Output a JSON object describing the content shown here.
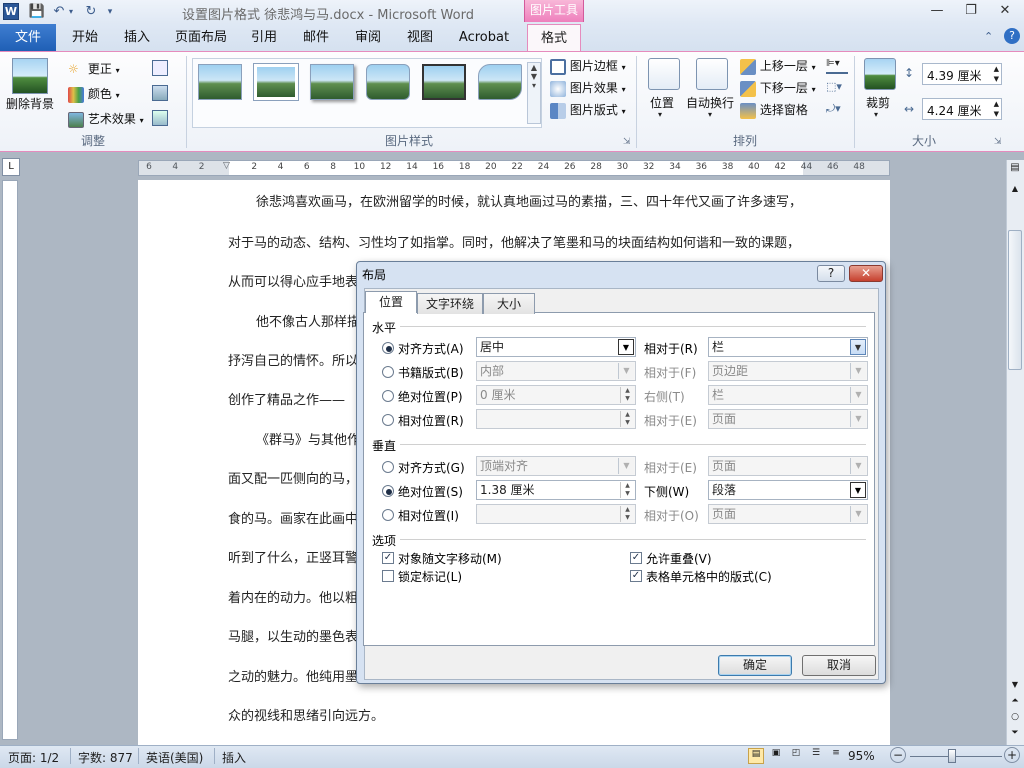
{
  "window": {
    "title": "设置图片格式 徐悲鸿与马.docx  -  Microsoft Word",
    "context_tab": "图片工具",
    "app_icon": "W",
    "controls": {
      "minimize": "—",
      "restore": "❐",
      "close": "✕"
    }
  },
  "tabs": {
    "file": "文件",
    "items": [
      "开始",
      "插入",
      "页面布局",
      "引用",
      "邮件",
      "审阅",
      "视图",
      "Acrobat"
    ],
    "active": "格式"
  },
  "ribbon": {
    "adjust": {
      "remove_bg": "删除背景",
      "corrections": "更正",
      "color": "颜色",
      "artistic": "艺术效果",
      "label": "调整"
    },
    "picture_styles": {
      "border": "图片边框",
      "effects": "图片效果",
      "layout": "图片版式",
      "label": "图片样式"
    },
    "arrange": {
      "position": "位置",
      "wrap": "自动换行",
      "bring_forward": "上移一层",
      "send_backward": "下移一层",
      "selection_pane": "选择窗格",
      "label": "排列"
    },
    "size": {
      "crop": "裁剪",
      "height": "4.39 厘米",
      "width": "4.24 厘米",
      "label": "大小"
    }
  },
  "ruler": {
    "ticks": [
      "6",
      "4",
      "2",
      "",
      "2",
      "4",
      "6",
      "8",
      "10",
      "12",
      "14",
      "16",
      "18",
      "20",
      "22",
      "24",
      "26",
      "28",
      "30",
      "32",
      "34",
      "36",
      "38",
      "40",
      "42",
      "44",
      "46",
      "48"
    ]
  },
  "document": {
    "paragraphs": [
      "徐悲鸿喜欢画马，在欧洲留学的时候，就认真地画过马的素描，三、四十年代又画了许多速写，",
      "对于马的动态、结构、习性均了如指掌。同时，他解决了笔墨和马的块面结构如何谐和一致的课题，",
      "从而可以得心应手地表",
      "他不像古人那样描",
      "抒泻自己的情怀。所以",
      "创作了精品之作——",
      "《群马》与其他作",
      "面又配一匹侧向的马，",
      "食的马。画家在此画中",
      "听到了什么，正竖耳警",
      "着内在的动力。他以粗",
      "马腿，以生动的墨色表",
      "之动的魅力。他纯用墨",
      "众的视线和思绪引向远方。"
    ]
  },
  "dialog": {
    "title": "布局",
    "help": "?",
    "close": "✕",
    "tabs": [
      "位置",
      "文字环绕",
      "大小"
    ],
    "horizontal": {
      "heading": "水平",
      "rows": [
        {
          "option": "对齐方式(A)",
          "value": "居中",
          "rel_label": "相对于(R)",
          "rel_value": "栏",
          "selected": true
        },
        {
          "option": "书籍版式(B)",
          "value": "内部",
          "rel_label": "相对于(F)",
          "rel_value": "页边距",
          "selected": false
        },
        {
          "option": "绝对位置(P)",
          "value": "0 厘米",
          "rel_label": "右侧(T)",
          "rel_value": "栏",
          "selected": false
        },
        {
          "option": "相对位置(R)",
          "value": "",
          "rel_label": "相对于(E)",
          "rel_value": "页面",
          "selected": false
        }
      ]
    },
    "vertical": {
      "heading": "垂直",
      "rows": [
        {
          "option": "对齐方式(G)",
          "value": "顶端对齐",
          "rel_label": "相对于(E)",
          "rel_value": "页面",
          "selected": false
        },
        {
          "option": "绝对位置(S)",
          "value": "1.38 厘米",
          "rel_label": "下侧(W)",
          "rel_value": "段落",
          "selected": true
        },
        {
          "option": "相对位置(I)",
          "value": "",
          "rel_label": "相对于(O)",
          "rel_value": "页面",
          "selected": false
        }
      ]
    },
    "options": {
      "heading": "选项",
      "items": [
        {
          "label": "对象随文字移动(M)",
          "checked": true
        },
        {
          "label": "允许重叠(V)",
          "checked": true
        },
        {
          "label": "锁定标记(L)",
          "checked": false
        },
        {
          "label": "表格单元格中的版式(C)",
          "checked": true
        }
      ]
    },
    "ok": "确定",
    "cancel": "取消"
  },
  "status": {
    "page": "页面: 1/2",
    "words": "字数: 877",
    "language": "英语(美国)",
    "mode": "插入",
    "zoom": "95%",
    "zoom_out": "−",
    "zoom_in": "+"
  }
}
